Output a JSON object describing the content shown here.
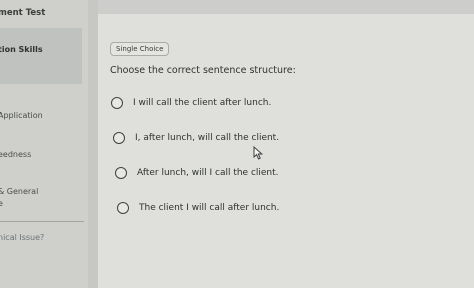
{
  "sidebar": {
    "title": "ment Test",
    "items": [
      {
        "label": "tion Skills",
        "active": true
      },
      {
        "label": "Application"
      },
      {
        "label": "eedness"
      },
      {
        "label": "& General"
      },
      {
        "label": "e"
      },
      {
        "label": "nical Issue?"
      }
    ]
  },
  "question": {
    "badge": "Single Choice",
    "prompt": "Choose the correct sentence structure:",
    "options": [
      "I will call the client after lunch.",
      "I, after lunch, will call the client.",
      "After lunch, will I call the client.",
      "The client I will call after lunch."
    ]
  },
  "icons": {
    "cursor": "mouse-pointer-icon"
  }
}
